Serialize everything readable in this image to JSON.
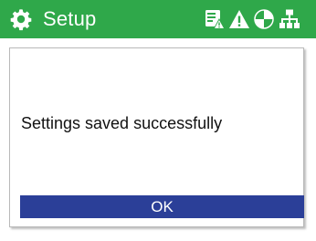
{
  "header": {
    "title": "Setup",
    "icon": "gear-icon",
    "status_icons": [
      "settings-warning-icon",
      "warning-icon",
      "pie-chart-icon",
      "network-icon"
    ],
    "background_color": "#2fa84a"
  },
  "dialog": {
    "message": "Settings saved successfully",
    "ok_label": "OK",
    "button_color": "#2b3f98"
  }
}
